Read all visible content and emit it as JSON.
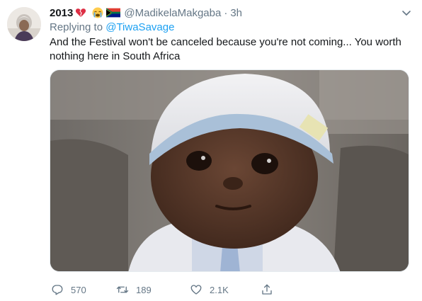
{
  "tweet": {
    "display_name": "2013",
    "name_emojis": [
      "broken-heart-emoji",
      "crying-face-emoji",
      "south-africa-flag-emoji"
    ],
    "handle": "@MadikelaMakgaba",
    "separator": "·",
    "time": "3h",
    "replying_prefix": "Replying to",
    "replying_to": "@TiwaSavage",
    "text": "And the Festival won't be canceled because you're not coming... You worth nothing here in South Africa",
    "media": {
      "alt_icon": "baby-photo"
    }
  },
  "actions": {
    "reply": {
      "icon": "reply-icon",
      "count": "570"
    },
    "retweet": {
      "icon": "retweet-icon",
      "count": "189"
    },
    "like": {
      "icon": "like-icon",
      "count": "2.1K"
    },
    "share": {
      "icon": "share-icon"
    }
  },
  "colors": {
    "link": "#1da1f2",
    "secondary_text": "#657786",
    "primary_text": "#14171a"
  }
}
